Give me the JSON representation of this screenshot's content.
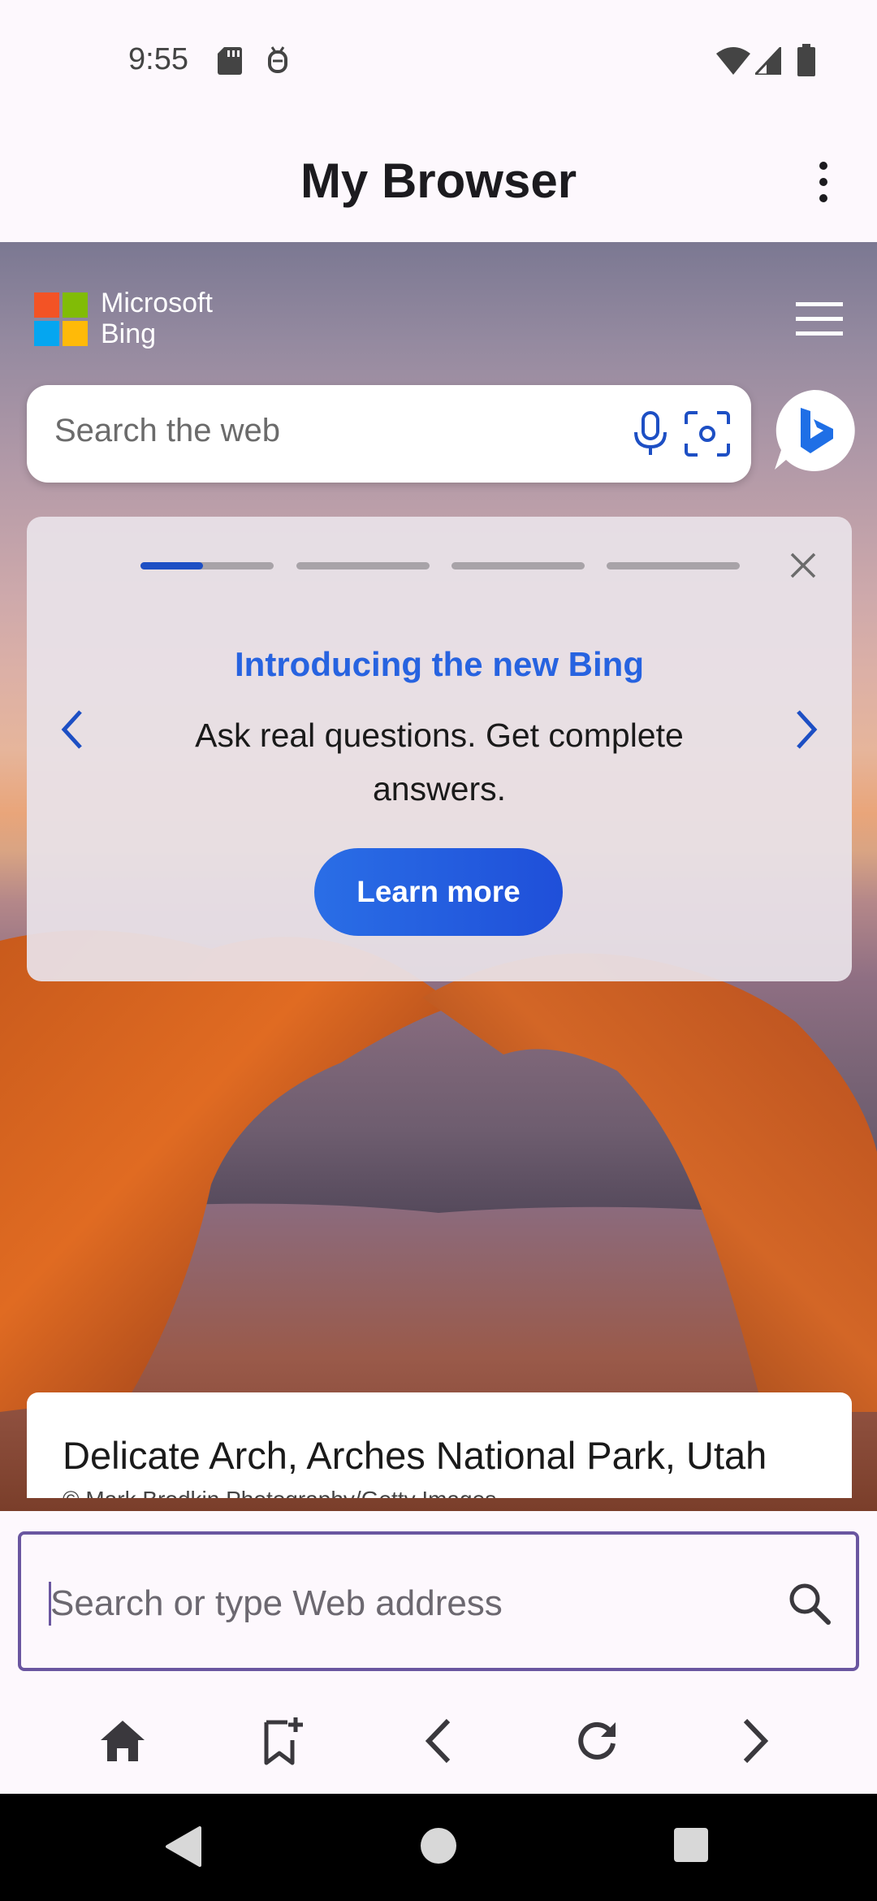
{
  "status_bar": {
    "time": "9:55",
    "icons": [
      "sd-card-icon",
      "debug-icon",
      "wifi-icon",
      "signal-icon",
      "battery-icon"
    ]
  },
  "app_bar": {
    "title": "My Browser",
    "overflow_icon": "more-vert-icon"
  },
  "bing_page": {
    "logo": {
      "line1": "Microsoft",
      "line2": "Bing"
    },
    "search": {
      "placeholder": "Search the web"
    },
    "promo": {
      "heading": "Introducing the new Bing",
      "body": "Ask real questions. Get complete answers.",
      "button": "Learn more",
      "progress": [
        0.47,
        0,
        0,
        0
      ]
    },
    "image_caption": "Delicate Arch, Arches National Park, Utah",
    "image_credit": "© Mark Brodkin Photography/Getty Images"
  },
  "address_bar": {
    "placeholder": "Search or type Web address"
  },
  "bottom_nav": [
    "home-icon",
    "add-bookmark-icon",
    "back-icon",
    "refresh-icon",
    "forward-icon"
  ],
  "colors": {
    "accent_purple": "#6a56a0",
    "bing_blue": "#2763e0",
    "button_blue": "#1f4fd9"
  }
}
